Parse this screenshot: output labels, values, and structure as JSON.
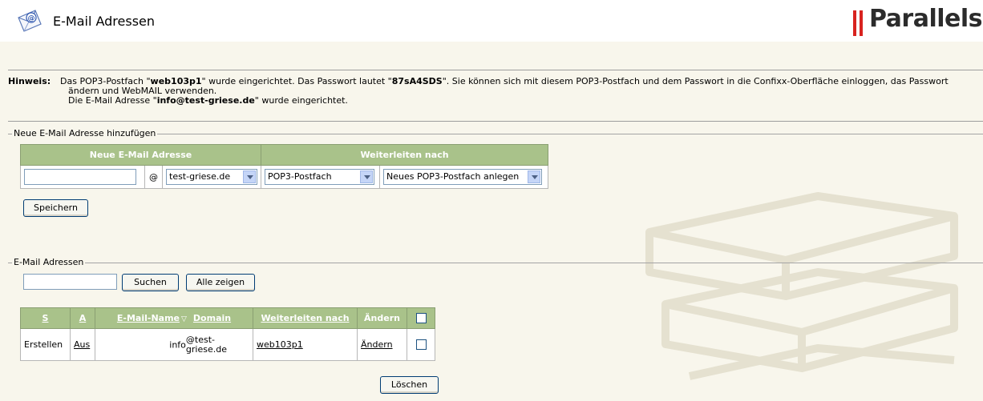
{
  "header": {
    "title": "E-Mail Adressen",
    "logo_text": "Parallels",
    "accent": "#d8231f"
  },
  "hint": {
    "label": "Hinweis:",
    "line1_a": "Das POP3-Postfach \"",
    "account": "web103p1",
    "line1_b": "\" wurde eingerichtet. Das Passwort lautet \"",
    "password": "87sA4SDS",
    "line1_c": "\". Sie können sich mit diesem POP3-Postfach und dem Passwort in die Confixx-Oberfläche einloggen, das Passwort",
    "line2": "ändern und WebMAIL verwenden.",
    "line3_a": "Die E-Mail Adresse \"",
    "address": "info@test-griese.de",
    "line3_b": "\" wurde eingerichtet."
  },
  "new_address": {
    "legend": "Neue E-Mail Adresse hinzufügen",
    "col_address": "Neue E-Mail Adresse",
    "col_forward": "Weiterleiten nach",
    "name_value": "",
    "at": "@",
    "domain_selected": "test-griese.de",
    "forward_type_selected": "POP3-Postfach",
    "forward_target_selected": "Neues POP3-Postfach anlegen",
    "save_label": "Speichern"
  },
  "address_list": {
    "legend": "E-Mail Adressen",
    "search_value": "",
    "search_label": "Suchen",
    "show_all_label": "Alle zeigen",
    "columns": {
      "s": "S",
      "a": "A",
      "email_name": "E-Mail-Name",
      "sort_marker": "▽",
      "domain": "Domain",
      "forward": "Weiterleiten nach",
      "edit": "Ändern"
    },
    "rows": [
      {
        "status": "Erstellen",
        "active": "Aus",
        "name": "info",
        "domain_line1": "@test-",
        "domain_line2": "griese.de",
        "forward": "web103p1",
        "edit": "Ändern",
        "checked": false
      }
    ],
    "delete_label": "Löschen"
  },
  "colors": {
    "background": "#f8f6ec",
    "header_green": "#a9c28a",
    "button_border": "#003c74"
  }
}
